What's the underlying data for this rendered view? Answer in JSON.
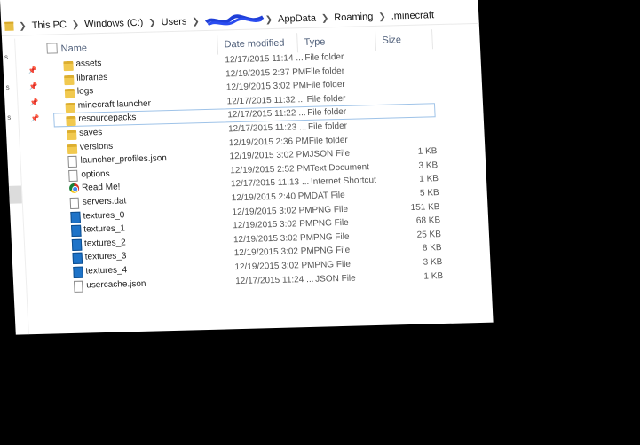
{
  "breadcrumb": {
    "items": [
      "This PC",
      "Windows (C:)",
      "Users",
      "AppData",
      "Roaming",
      ".minecraft"
    ],
    "redacted_segment": "redacted-username"
  },
  "header": {
    "name": "Name",
    "date": "Date modified",
    "type": "Type",
    "size": "Size"
  },
  "files": [
    {
      "name": "assets",
      "date": "12/17/2015 11:14 ...",
      "type": "File folder",
      "size": "",
      "icon": "folder-icon"
    },
    {
      "name": "libraries",
      "date": "12/19/2015 2:37 PM",
      "type": "File folder",
      "size": "",
      "icon": "folder-icon"
    },
    {
      "name": "logs",
      "date": "12/19/2015 3:02 PM",
      "type": "File folder",
      "size": "",
      "icon": "folder-icon"
    },
    {
      "name": "minecraft launcher",
      "date": "12/17/2015 11:32 ...",
      "type": "File folder",
      "size": "",
      "icon": "folder-icon"
    },
    {
      "name": "resourcepacks",
      "date": "12/17/2015 11:22 ...",
      "type": "File folder",
      "size": "",
      "icon": "folder-icon"
    },
    {
      "name": "saves",
      "date": "12/17/2015 11:23 ...",
      "type": "File folder",
      "size": "",
      "icon": "folder-icon"
    },
    {
      "name": "versions",
      "date": "12/19/2015 2:36 PM",
      "type": "File folder",
      "size": "",
      "icon": "folder-icon"
    },
    {
      "name": "launcher_profiles.json",
      "date": "12/19/2015 3:02 PM",
      "type": "JSON File",
      "size": "1 KB",
      "icon": "file-icon"
    },
    {
      "name": "options",
      "date": "12/19/2015 2:52 PM",
      "type": "Text Document",
      "size": "3 KB",
      "icon": "file-icon"
    },
    {
      "name": "Read Me!",
      "date": "12/17/2015 11:13 ...",
      "type": "Internet Shortcut",
      "size": "1 KB",
      "icon": "chrome-icon"
    },
    {
      "name": "servers.dat",
      "date": "12/19/2015 2:40 PM",
      "type": "DAT File",
      "size": "5 KB",
      "icon": "file-icon"
    },
    {
      "name": "textures_0",
      "date": "12/19/2015 3:02 PM",
      "type": "PNG File",
      "size": "151 KB",
      "icon": "image-icon"
    },
    {
      "name": "textures_1",
      "date": "12/19/2015 3:02 PM",
      "type": "PNG File",
      "size": "68 KB",
      "icon": "image-icon"
    },
    {
      "name": "textures_2",
      "date": "12/19/2015 3:02 PM",
      "type": "PNG File",
      "size": "25 KB",
      "icon": "image-icon"
    },
    {
      "name": "textures_3",
      "date": "12/19/2015 3:02 PM",
      "type": "PNG File",
      "size": "8 KB",
      "icon": "image-icon"
    },
    {
      "name": "textures_4",
      "date": "12/19/2015 3:02 PM",
      "type": "PNG File",
      "size": "3 KB",
      "icon": "image-icon"
    },
    {
      "name": "usercache.json",
      "date": "12/17/2015 11:24 ...",
      "type": "JSON File",
      "size": "1 KB",
      "icon": "file-icon"
    }
  ],
  "highlighted_row": 4,
  "colors": {
    "folder": "#f1c94f",
    "header_text": "#4f5f7a",
    "selection_outline": "#9fc3e8",
    "redaction": "#1f3fd8"
  }
}
